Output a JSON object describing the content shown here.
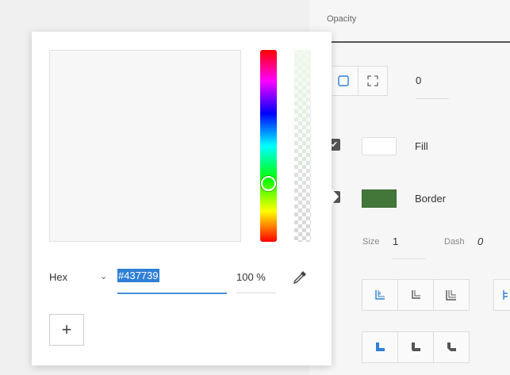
{
  "right_panel": {
    "opacity_label": "Opacity",
    "corner_radius_value": "0",
    "fill": {
      "label": "Fill",
      "color": "#ffffff",
      "checked": true
    },
    "border": {
      "label": "Border",
      "color": "#437739",
      "checked": true
    },
    "size": {
      "label": "Size",
      "value": "1"
    },
    "dash": {
      "label": "Dash",
      "value": "0"
    },
    "accent_color": "#2f7fd6"
  },
  "color_picker": {
    "format_label": "Hex",
    "hex_value": "#437739",
    "opacity_value": "100 %",
    "add_button_label": "+",
    "hue_color": "#00ff00"
  }
}
